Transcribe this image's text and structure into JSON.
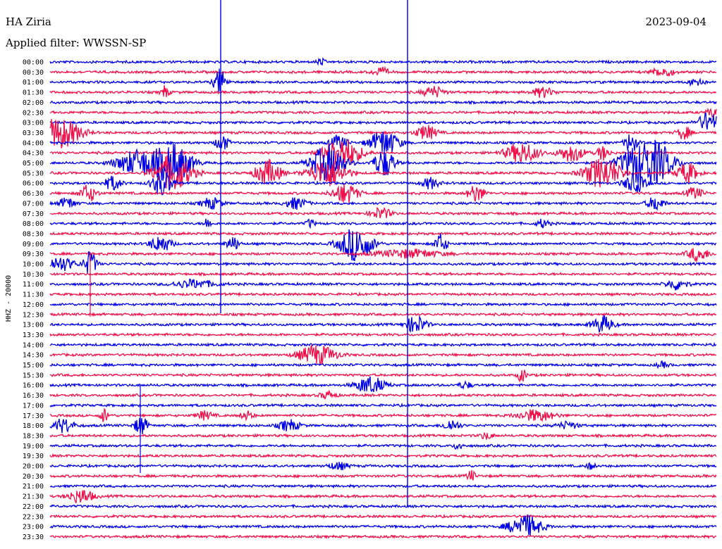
{
  "header": {
    "station": "HA Ziria",
    "filter": "Applied filter: WWSSN-SP",
    "date": "2023-09-04"
  },
  "colors": {
    "blue": "#0000e6",
    "red": "#f0104a"
  },
  "chart_data": {
    "type": "line",
    "title": "",
    "ylabel": "HHZ - 20000",
    "row_labels": [
      "00:00",
      "00:30",
      "01:00",
      "01:30",
      "02:00",
      "02:30",
      "03:00",
      "03:30",
      "04:00",
      "04:30",
      "05:00",
      "05:30",
      "06:00",
      "06:30",
      "07:00",
      "07:30",
      "08:00",
      "08:30",
      "09:00",
      "09:30",
      "10:00",
      "10:30",
      "11:00",
      "11:30",
      "12:00",
      "12:30",
      "13:00",
      "13:30",
      "14:00",
      "14:30",
      "15:00",
      "15:30",
      "16:00",
      "16:30",
      "17:00",
      "17:30",
      "18:00",
      "18:30",
      "19:00",
      "19:30",
      "20:00",
      "20:30",
      "21:00",
      "21:30",
      "22:00",
      "22:30",
      "23:00",
      "23:30"
    ],
    "series_colors": [
      "blue",
      "red"
    ],
    "x_range_minutes": [
      0,
      30
    ]
  }
}
